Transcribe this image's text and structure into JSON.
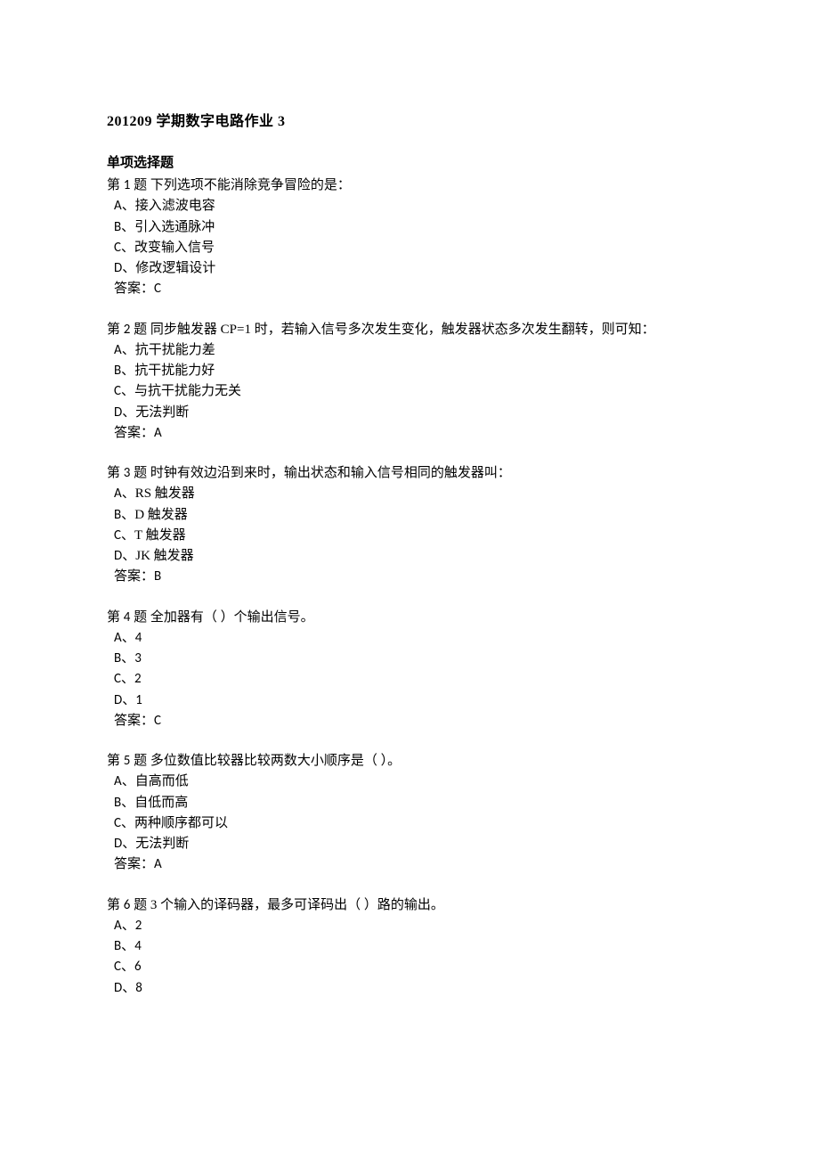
{
  "title": "201209 学期数字电路作业 3",
  "section_heading": "单项选择题",
  "questions": [
    {
      "num_prefix": "第 ",
      "num": "1",
      "num_suffix": " 题 ",
      "stem": "下列选项不能消除竞争冒险的是：",
      "options": [
        {
          "letter": "A",
          "sep": "、",
          "text": "接入滤波电容"
        },
        {
          "letter": "B",
          "sep": "、",
          "text": "引入选通脉冲"
        },
        {
          "letter": "C",
          "sep": "、",
          "text": "改变输入信号"
        },
        {
          "letter": "D",
          "sep": "、",
          "text": "修改逻辑设计"
        }
      ],
      "answer_label": "答案：",
      "answer": "C"
    },
    {
      "num_prefix": "第 ",
      "num": "2",
      "num_suffix": " 题 ",
      "stem": "同步触发器 CP=1 时，若输入信号多次发生变化，触发器状态多次发生翻转，则可知：",
      "options": [
        {
          "letter": "A",
          "sep": "、",
          "text": "抗干扰能力差"
        },
        {
          "letter": "B",
          "sep": "、",
          "text": "抗干扰能力好"
        },
        {
          "letter": "C",
          "sep": "、",
          "text": "与抗干扰能力无关"
        },
        {
          "letter": "D",
          "sep": "、",
          "text": "无法判断"
        }
      ],
      "answer_label": "答案：",
      "answer": "A"
    },
    {
      "num_prefix": "第 ",
      "num": "3",
      "num_suffix": " 题 ",
      "stem": "时钟有效边沿到来时，输出状态和输入信号相同的触发器叫：",
      "options": [
        {
          "letter": "A",
          "sep": "、",
          "text": "RS 触发器"
        },
        {
          "letter": "B",
          "sep": "、",
          "text": "D 触发器"
        },
        {
          "letter": "C",
          "sep": "、",
          "text": "T 触发器"
        },
        {
          "letter": "D",
          "sep": "、",
          "text": "JK 触发器"
        }
      ],
      "answer_label": "答案：",
      "answer": "B"
    },
    {
      "num_prefix": "第 ",
      "num": "4",
      "num_suffix": " 题 ",
      "stem": "全加器有（ ）个输出信号。",
      "options": [
        {
          "letter": "A",
          "sep": "、",
          "text": "4"
        },
        {
          "letter": "B",
          "sep": "、",
          "text": "3"
        },
        {
          "letter": "C",
          "sep": "、",
          "text": "2"
        },
        {
          "letter": "D",
          "sep": "、",
          "text": "1"
        }
      ],
      "answer_label": "答案：",
      "answer": "C"
    },
    {
      "num_prefix": "第 ",
      "num": "5",
      "num_suffix": " 题 ",
      "stem": "多位数值比较器比较两数大小顺序是（ ）。",
      "options": [
        {
          "letter": "A",
          "sep": "、",
          "text": "自高而低"
        },
        {
          "letter": "B",
          "sep": "、",
          "text": "自低而高"
        },
        {
          "letter": "C",
          "sep": "、",
          "text": "两种顺序都可以"
        },
        {
          "letter": "D",
          "sep": "、",
          "text": "无法判断"
        }
      ],
      "answer_label": "答案：",
      "answer": "A"
    },
    {
      "num_prefix": "第 ",
      "num": "6",
      "num_suffix": " 题 ",
      "stem": "3 个输入的译码器，最多可译码出（ ）路的输出。",
      "options": [
        {
          "letter": "A",
          "sep": "、",
          "text": "2"
        },
        {
          "letter": "B",
          "sep": "、",
          "text": "4"
        },
        {
          "letter": "C",
          "sep": "、",
          "text": "6"
        },
        {
          "letter": "D",
          "sep": "、",
          "text": "8"
        }
      ],
      "answer_label": "",
      "answer": ""
    }
  ]
}
